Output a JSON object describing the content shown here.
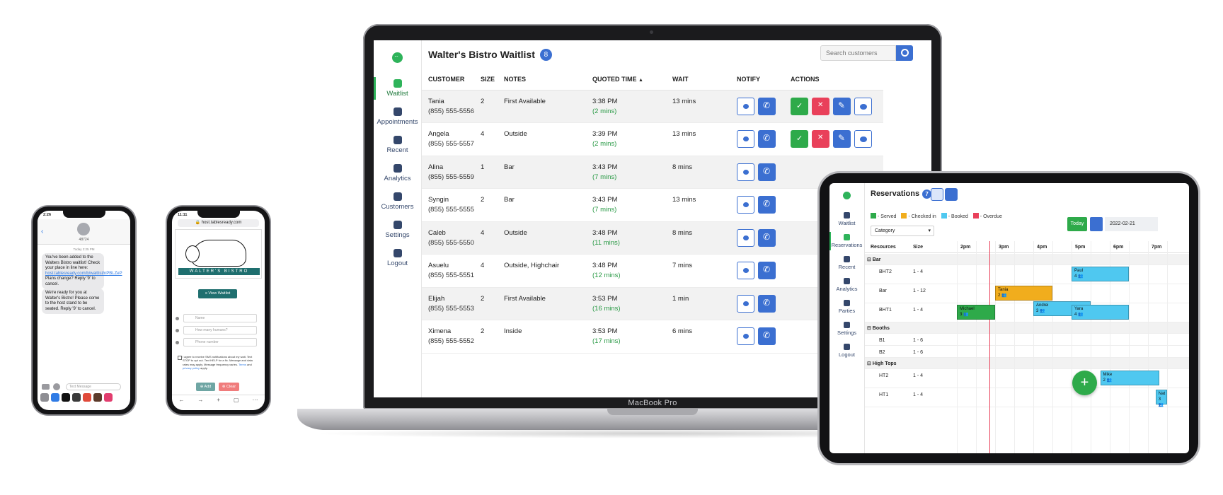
{
  "laptop": {
    "brand": "MacBook Pro",
    "app": {
      "title": "Walter's Bistro Waitlist",
      "count": "8",
      "search_placeholder": "Search customers",
      "sidebar": [
        {
          "label": "Waitlist",
          "icon": "calendar-icon",
          "active": true
        },
        {
          "label": "Appointments",
          "icon": "bar-chart-icon",
          "active": false
        },
        {
          "label": "Recent",
          "icon": "clock-icon",
          "active": false
        },
        {
          "label": "Analytics",
          "icon": "analytics-icon",
          "active": false
        },
        {
          "label": "Customers",
          "icon": "users-icon",
          "active": false
        },
        {
          "label": "Settings",
          "icon": "gear-icon",
          "active": false
        },
        {
          "label": "Logout",
          "icon": "logout-icon",
          "active": false
        }
      ],
      "columns": {
        "customer": "CUSTOMER",
        "size": "SIZE",
        "notes": "NOTES",
        "quoted": "QUOTED TIME",
        "sort_icon": "▲",
        "wait": "WAIT",
        "notify": "NOTIFY",
        "actions": "ACTIONS"
      },
      "rows": [
        {
          "name": "Tania",
          "phone": "(855) 555-5556",
          "size": "2",
          "notes": "First Available",
          "time": "3:38 PM",
          "mins": "(2 mins)",
          "wait": "13 mins"
        },
        {
          "name": "Angela",
          "phone": "(855) 555-5557",
          "size": "4",
          "notes": "Outside",
          "time": "3:39 PM",
          "mins": "(2 mins)",
          "wait": "13 mins"
        },
        {
          "name": "Alina",
          "phone": "(855) 555-5559",
          "size": "1",
          "notes": "Bar",
          "time": "3:43 PM",
          "mins": "(7 mins)",
          "wait": "8 mins"
        },
        {
          "name": "Syngin",
          "phone": "(855) 555-5555",
          "size": "2",
          "notes": "Bar",
          "time": "3:43 PM",
          "mins": "(7 mins)",
          "wait": "13 mins"
        },
        {
          "name": "Caleb",
          "phone": "(855) 555-5550",
          "size": "4",
          "notes": "Outside",
          "time": "3:48 PM",
          "mins": "(11 mins)",
          "wait": "8 mins"
        },
        {
          "name": "Asuelu",
          "phone": "(855) 555-5551",
          "size": "4",
          "notes": "Outside, Highchair",
          "time": "3:48 PM",
          "mins": "(12 mins)",
          "wait": "7 mins"
        },
        {
          "name": "Elijah",
          "phone": "(855) 555-5553",
          "size": "2",
          "notes": "First Available",
          "time": "3:53 PM",
          "mins": "(16 mins)",
          "wait": "1 min"
        },
        {
          "name": "Ximena",
          "phone": "(855) 555-5552",
          "size": "2",
          "notes": "Inside",
          "time": "3:53 PM",
          "mins": "(17 mins)",
          "wait": "6 mins"
        }
      ]
    }
  },
  "tablet": {
    "title": "Reservations",
    "count": "7",
    "sidebar": [
      {
        "label": "Waitlist",
        "icon": "calendar-icon",
        "active": false
      },
      {
        "label": "Reservations",
        "icon": "bar-chart-icon",
        "active": true
      },
      {
        "label": "Recent",
        "icon": "clock-icon",
        "active": false
      },
      {
        "label": "Analytics",
        "icon": "analytics-icon",
        "active": false
      },
      {
        "label": "Parties",
        "icon": "users-icon",
        "active": false
      },
      {
        "label": "Settings",
        "icon": "gear-icon",
        "active": false
      },
      {
        "label": "Logout",
        "icon": "logout-icon",
        "active": false
      }
    ],
    "legend": [
      {
        "label": "- Served",
        "color": "#2eaa4a"
      },
      {
        "label": "- Checked in",
        "color": "#f1ad1d"
      },
      {
        "label": "- Booked",
        "color": "#4fc8f0"
      },
      {
        "label": "- Overdue",
        "color": "#e9405a"
      }
    ],
    "category_select": "Category",
    "today_label": "Today",
    "date_value": "2022-02-21",
    "headers": {
      "resources": "Resources",
      "size": "Size"
    },
    "times": [
      "2pm",
      "3pm",
      "4pm",
      "5pm",
      "6pm",
      "7pm"
    ],
    "groups": [
      {
        "type": "cat",
        "name": "⊟ Bar"
      },
      {
        "type": "res",
        "name": "BHT2",
        "size": "1 - 4"
      },
      {
        "type": "res",
        "name": "Bar",
        "size": "1 - 12"
      },
      {
        "type": "res",
        "name": "BHT1",
        "size": "1 - 4"
      },
      {
        "type": "cat",
        "name": "⊟ Booths"
      },
      {
        "type": "res",
        "name": "B1",
        "size": "1 - 6"
      },
      {
        "type": "res",
        "name": "B2",
        "size": "1 - 6"
      },
      {
        "type": "cat",
        "name": "⊟ High Tops"
      },
      {
        "type": "res",
        "name": "HT2",
        "size": "1 - 4"
      },
      {
        "type": "res",
        "name": "HT1",
        "size": "1 - 4"
      }
    ],
    "bookings": [
      {
        "name": "Paul",
        "size": "4",
        "row": 1,
        "start": 5.0,
        "end": 6.5,
        "color": "#4fc8f0"
      },
      {
        "name": "Tania",
        "size": "2",
        "row": 2,
        "start": 3.0,
        "end": 4.5,
        "color": "#f1ad1d"
      },
      {
        "name": "Andrei",
        "size": "3",
        "row": 2,
        "start": 4.0,
        "end": 5.5,
        "color": "#4fc8f0",
        "offset": 1
      },
      {
        "name": "Michael",
        "size": "3",
        "row": 3,
        "start": 2.0,
        "end": 3.0,
        "color": "#2eaa4a"
      },
      {
        "name": "Yara",
        "size": "4",
        "row": 3,
        "start": 5.0,
        "end": 6.5,
        "color": "#4fc8f0"
      },
      {
        "name": "Mike",
        "size": "2",
        "row": 8,
        "start": 5.75,
        "end": 7.3,
        "color": "#4fc8f0"
      },
      {
        "name": "Nat",
        "size": "3",
        "row": 9,
        "start": 7.2,
        "end": 7.5,
        "color": "#4fc8f0"
      }
    ],
    "now_time": 2.85
  },
  "phone1": {
    "time": "2:26",
    "contact_number": "48724",
    "date": "Today 2:25 PM",
    "bubble1_a": "You've been added to the Walters Bistro waitlist! Check your place in line here: ",
    "bubble1_link": "host.tablesready.com/b/waitlist/nPBLZeP",
    "bubble1_b": " Plans change? Reply '9' to cancel.",
    "bubble2": "We're ready for you at Walter's Bistro! Please come to the host stand to be seated. Reply '9' to cancel.",
    "input_placeholder": "Text Message"
  },
  "phone2": {
    "time": "11:11",
    "url": "🔒 host.tablesready.com",
    "banner": "WALTER'S BISTRO",
    "view_waitlist": "≡ View Waitlist",
    "fields": [
      "Name",
      "How many humans?",
      "Phone number"
    ],
    "consent_a": "I agree to receive SMS notifications about my wait. Text STOP to opt out. Text HELP for a fix. Message and data rates may apply. Message frequency varies. ",
    "consent_terms": "Terms",
    "consent_mid": " and ",
    "consent_privacy": "privacy policy",
    "consent_b": " apply.",
    "add_label": "⊕ Add",
    "clear_label": "⊗ Clear"
  }
}
